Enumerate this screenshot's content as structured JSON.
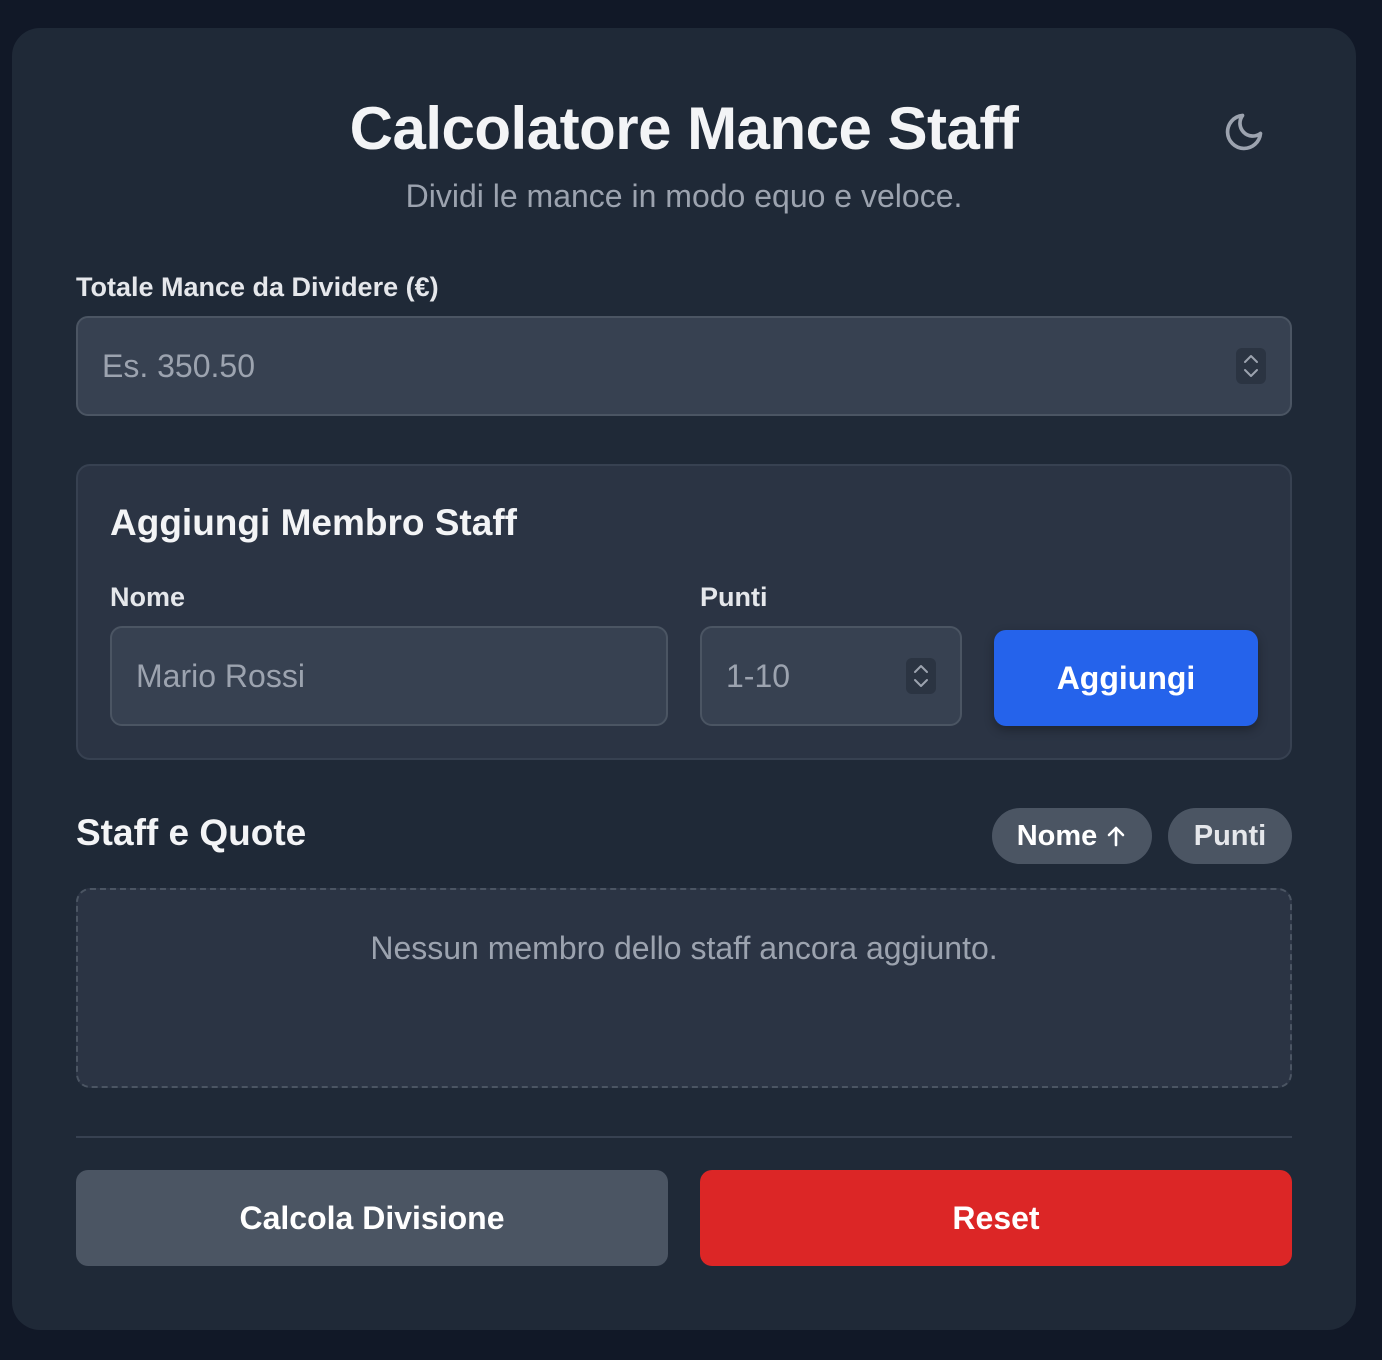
{
  "header": {
    "title": "Calcolatore Mance Staff",
    "subtitle": "Dividi le mance in modo equo e veloce.",
    "theme_icon": "moon-icon"
  },
  "total": {
    "label": "Totale Mance da Dividere (€)",
    "value": "",
    "placeholder": "Es. 350.50"
  },
  "add_member": {
    "title": "Aggiungi Membro Staff",
    "name_label": "Nome",
    "name_value": "",
    "name_placeholder": "Mario Rossi",
    "points_label": "Punti",
    "points_value": "",
    "points_placeholder": "1-10",
    "add_button": "Aggiungi"
  },
  "staff_list": {
    "title": "Staff e Quote",
    "sort_name_label": "Nome",
    "sort_name_icon": "arrow-up-icon",
    "sort_points_label": "Punti",
    "empty_message": "Nessun membro dello staff ancora aggiunto."
  },
  "actions": {
    "calculate_label": "Calcola Divisione",
    "reset_label": "Reset"
  },
  "colors": {
    "page_bg": "#111827",
    "card_bg": "#1f2937",
    "primary": "#2563eb",
    "danger": "#dc2626",
    "secondary": "#4b5563"
  }
}
